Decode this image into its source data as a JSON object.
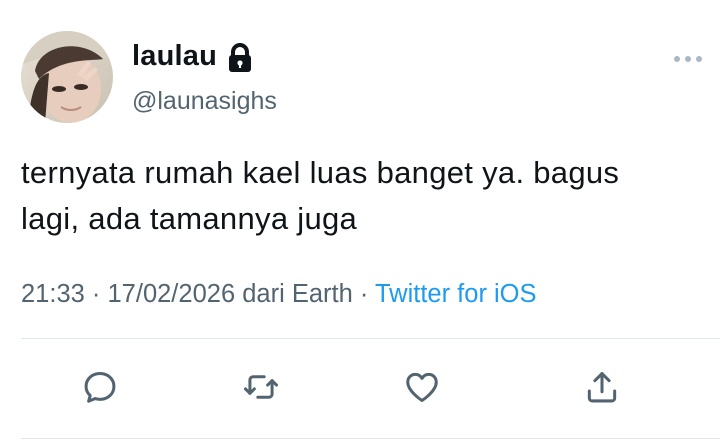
{
  "user": {
    "display_name": "laulau",
    "handle": "@launasighs",
    "avatar_icon": "user-photo",
    "protected_icon": "lock-icon"
  },
  "tweet": {
    "text": "ternyata rumah kael luas banget ya. bagus\nlagi, ada tamannya juga",
    "time": "21:33",
    "date": "17/02/2026",
    "location": "dari Earth",
    "source": "Twitter for iOS",
    "separator": "·"
  },
  "actions": [
    {
      "icon": "reply-icon"
    },
    {
      "icon": "retweet-icon"
    },
    {
      "icon": "like-icon"
    },
    {
      "icon": "share-icon"
    }
  ],
  "colors": {
    "text": "#0f1419",
    "secondary": "#536471",
    "link": "#1d9bf0",
    "divider": "#e1e6ea"
  }
}
